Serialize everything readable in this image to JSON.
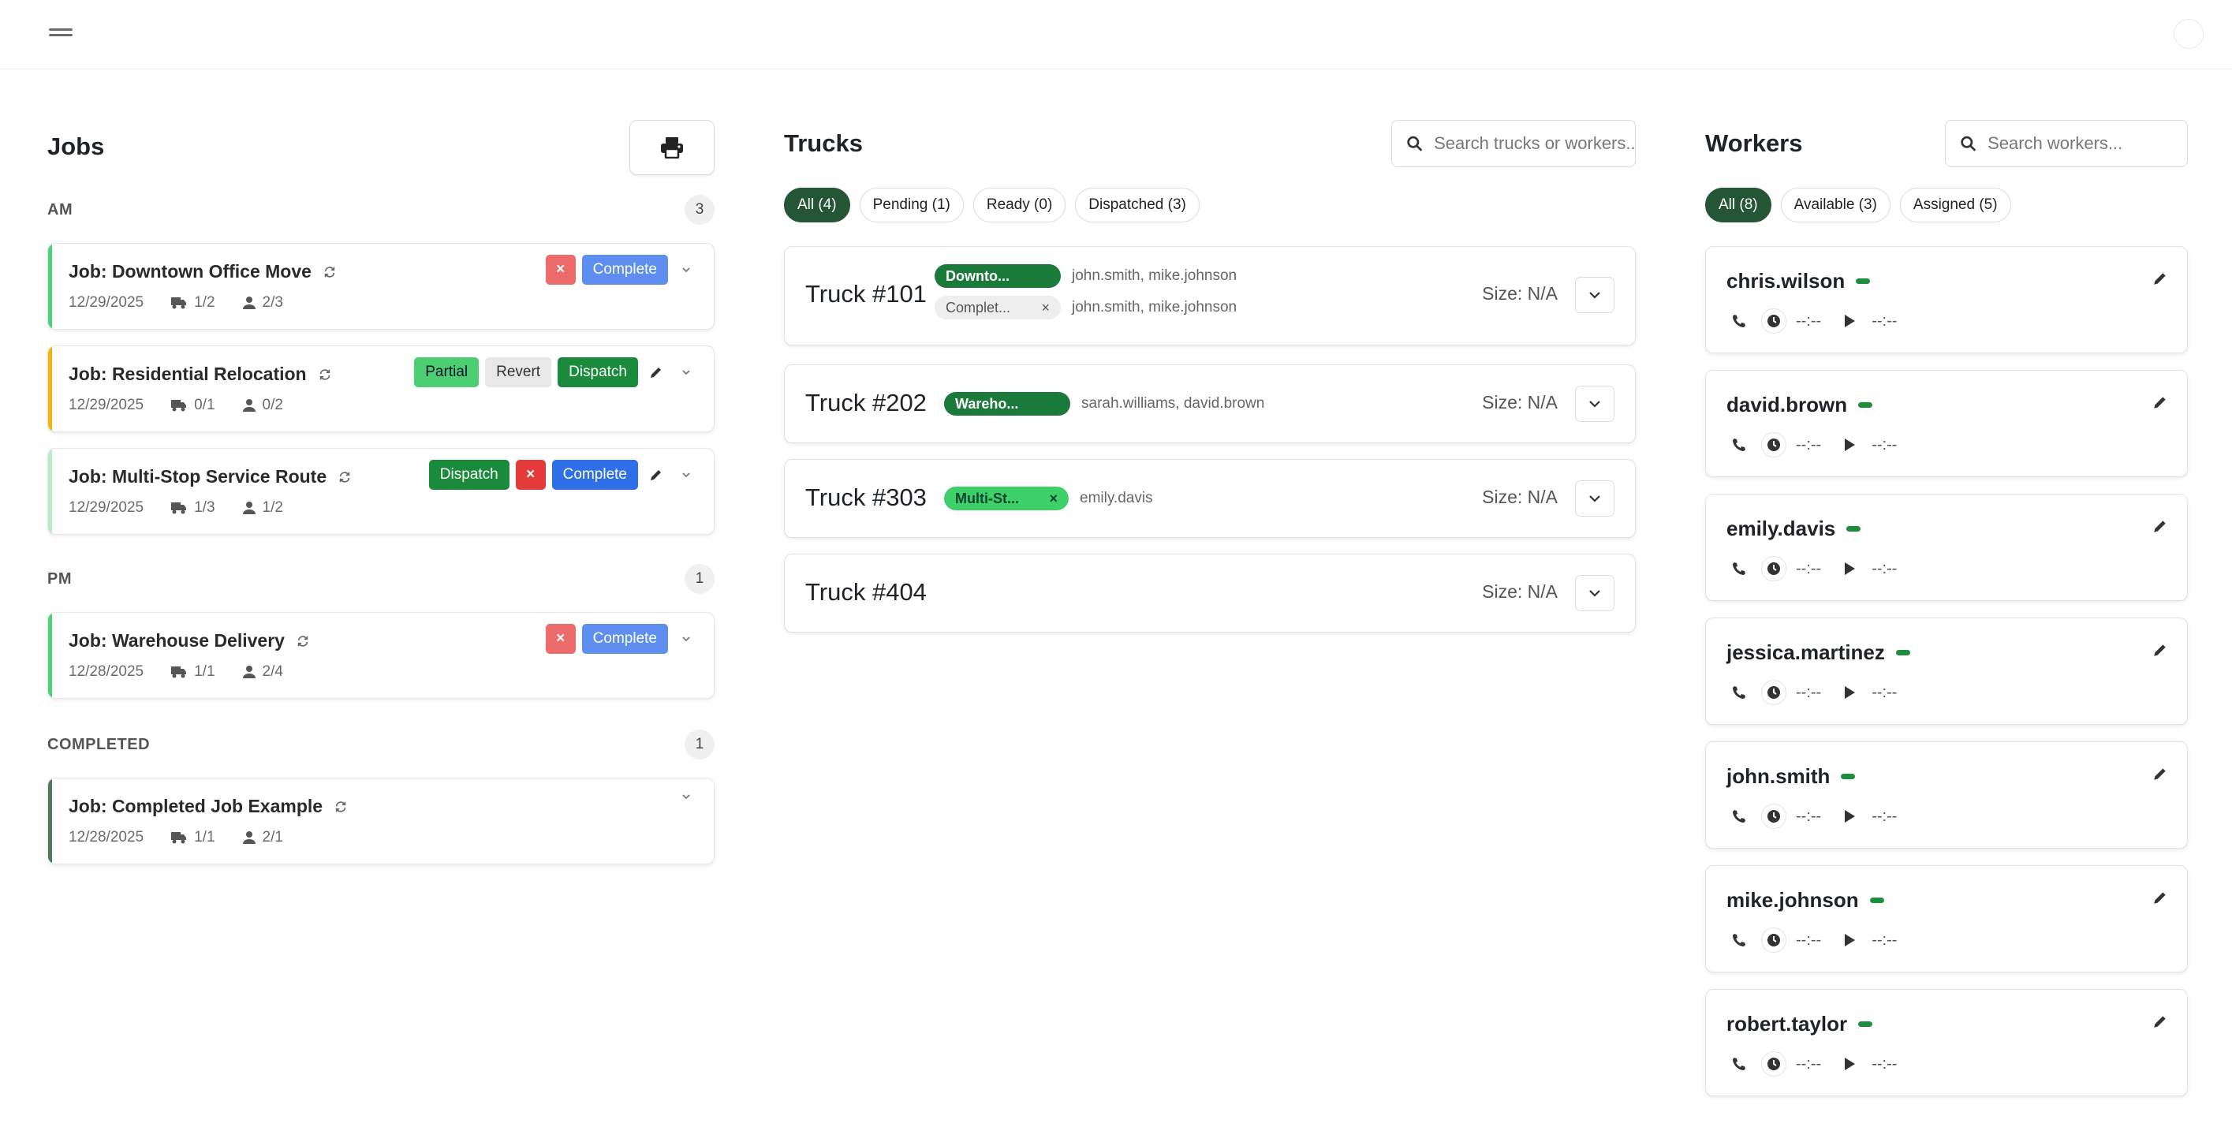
{
  "jobs": {
    "title": "Jobs",
    "groups": [
      {
        "label": "AM",
        "count": "3",
        "jobs": [
          {
            "title": "Job: Downtown Office Move",
            "date": "12/29/2025",
            "trucks": "1/2",
            "workers": "2/3"
          },
          {
            "title": "Job: Residential Relocation",
            "date": "12/29/2025",
            "trucks": "0/1",
            "workers": "0/2"
          },
          {
            "title": "Job: Multi-Stop Service Route",
            "date": "12/29/2025",
            "trucks": "1/3",
            "workers": "1/2"
          }
        ]
      },
      {
        "label": "PM",
        "count": "1",
        "jobs": [
          {
            "title": "Job: Warehouse Delivery",
            "date": "12/28/2025",
            "trucks": "1/1",
            "workers": "2/4"
          }
        ]
      },
      {
        "label": "COMPLETED",
        "count": "1",
        "jobs": [
          {
            "title": "Job: Completed Job Example",
            "date": "12/28/2025",
            "trucks": "1/1",
            "workers": "2/1"
          }
        ]
      }
    ],
    "buttons": {
      "complete": "Complete",
      "dispatch": "Dispatch",
      "partial": "Partial",
      "revert": "Revert",
      "close": "×"
    },
    "colors": {
      "stripe_green": "#4cd07a",
      "stripe_yellow": "#f2b705",
      "stripe_light": "#b8ecc8",
      "stripe_completed": "#4f7a5d"
    }
  },
  "trucks": {
    "title": "Trucks",
    "search_placeholder": "Search trucks or workers...",
    "filters": [
      "All (4)",
      "Pending (1)",
      "Ready (0)",
      "Dispatched (3)"
    ],
    "size_label": "Size: N/A",
    "items": [
      {
        "name": "Truck #101",
        "assignments": [
          {
            "tag": "Downto...",
            "names": "john.smith, mike.johnson"
          },
          {
            "tag": "Complet...",
            "close": "×",
            "names": "john.smith, mike.johnson"
          }
        ]
      },
      {
        "name": "Truck #202",
        "assignments": [
          {
            "tag": "Wareho...",
            "names": "sarah.williams, david.brown"
          }
        ]
      },
      {
        "name": "Truck #303",
        "assignments": [
          {
            "tag": "Multi-St...",
            "close": "×",
            "names": "emily.davis"
          }
        ]
      },
      {
        "name": "Truck #404",
        "assignments": []
      }
    ]
  },
  "workers": {
    "title": "Workers",
    "search_placeholder": "Search workers...",
    "filters": [
      "All (8)",
      "Available (3)",
      "Assigned (5)"
    ],
    "time_placeholder": "--:--",
    "items": [
      "chris.wilson",
      "david.brown",
      "emily.davis",
      "jessica.martinez",
      "john.smith",
      "mike.johnson",
      "robert.taylor"
    ],
    "status_color": "#1e8e3e"
  }
}
